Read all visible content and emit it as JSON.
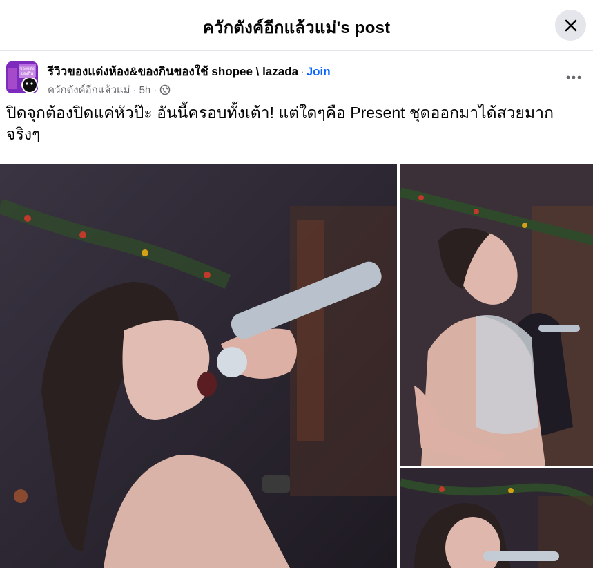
{
  "header": {
    "title": "ควักตังค์อีกแล้วแม่'s post",
    "close_icon": "close-icon"
  },
  "post": {
    "group_name": "รีวิวของแต่งห้อง&ของกินของใช้ shopee \\ lazada",
    "separator": "·",
    "join_label": "Join",
    "author": "ควักตังค์อีกแล้วแม่",
    "time": "5h",
    "privacy_icon": "globe-icon",
    "more_icon": "more-icon",
    "text": "ปิดจุกต้องปิดแค่หัวป๊ะ อันนี้ครอบทั้งเต้า! แต่ใดๆคือ Present ชุดออกมาได้สวยมาก จริงๆ",
    "avatar_text": "ของแต่ง ของกิน"
  },
  "colors": {
    "accent": "#0866ff",
    "secondary_text": "#65676b",
    "close_bg": "#e4e6eb"
  }
}
